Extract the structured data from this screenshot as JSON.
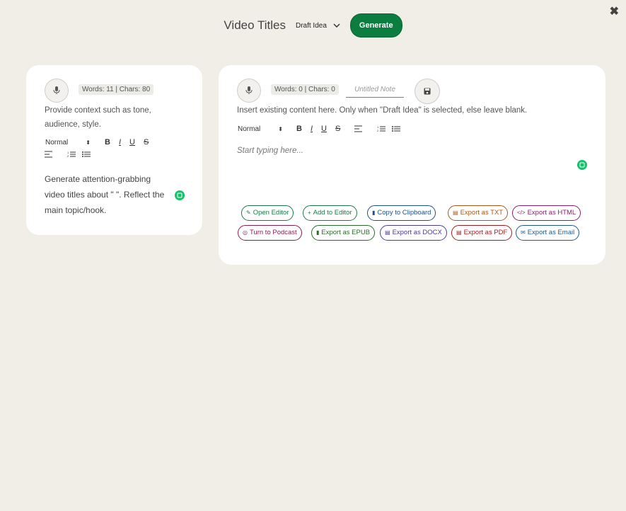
{
  "close": {
    "icon": "close-icon",
    "glyph": "✖"
  },
  "header": {
    "title": "Video Titles",
    "mode_selected": "Draft Idea",
    "generate_label": "Generate",
    "generate_color": "#0b7d3f"
  },
  "context_panel": {
    "counter": "Words: 11 | Chars: 80",
    "hint": "Provide context such as tone, audience, style.",
    "format_select": "Normal",
    "content": "Generate attention-grabbing video titles about \" \". Reflect the main topic/hook."
  },
  "editor_panel": {
    "counter": "Words: 0 | Chars: 0",
    "note_title_placeholder": "Untitled Note",
    "hint": "Insert existing content here. Only when \"Draft Idea\" is selected, else leave blank.",
    "format_select": "Normal",
    "placeholder": "Start typing here..."
  },
  "toolbar_glyphs": {
    "bold": "B",
    "italic": "I",
    "underline": "U",
    "strike": "S"
  },
  "actions": [
    {
      "label": "Open Editor",
      "icon": "pencil-icon",
      "color": "#1b7a45"
    },
    {
      "label": "Add to Editor",
      "icon": "plus-icon",
      "color": "#1b7a45"
    },
    {
      "label": "Copy to Clipboard",
      "icon": "clipboard-icon",
      "color": "#1f4f8f"
    },
    {
      "label": "Export as TXT",
      "icon": "file-text-icon",
      "color": "#b0561a"
    },
    {
      "label": "Export as HTML",
      "icon": "code-icon",
      "color": "#8a1f6b"
    },
    {
      "label": "Turn to Podcast",
      "icon": "podcast-icon",
      "color": "#8a1f4f"
    },
    {
      "label": "Export as EPUB",
      "icon": "book-icon",
      "color": "#2a6a2a"
    },
    {
      "label": "Export as DOCX",
      "icon": "word-icon",
      "color": "#4a3a9a"
    },
    {
      "label": "Export as PDF",
      "icon": "pdf-icon",
      "color": "#a01f1f"
    },
    {
      "label": "Export as Email",
      "icon": "envelope-icon",
      "color": "#1f5a8a"
    }
  ]
}
